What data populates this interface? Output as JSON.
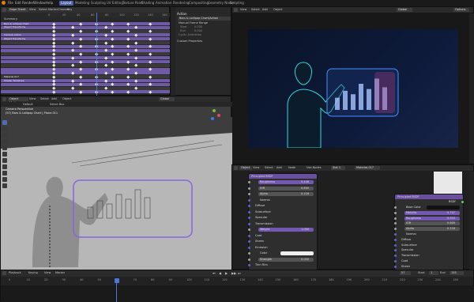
{
  "menu": {
    "file": "File",
    "edit": "Edit",
    "render": "Render",
    "window": "Window",
    "help": "Help"
  },
  "workspaces": [
    "Layout",
    "Modeling",
    "Sculpting",
    "UV Editing",
    "Texture Paint",
    "Shading",
    "Animation",
    "Rendering",
    "Compositing",
    "Geometry Nodes",
    "Scripting"
  ],
  "active_workspace": "Layout",
  "dopesheet": {
    "mode": "Dope Sheet",
    "menus": [
      "View",
      "Select",
      "Marker",
      "Channel",
      "Key"
    ],
    "summary": "Summary",
    "frames": [
      "0",
      "20",
      "40",
      "60",
      "80",
      "100",
      "120",
      "140",
      "160"
    ],
    "channels": [
      "Bars & Lollipop Chart",
      "Object Transforms",
      "",
      "Camera Action",
      "Object Transforms",
      "",
      "",
      "",
      "",
      "",
      "",
      "",
      "",
      "",
      "Material.017",
      "Shader Nodetree",
      "",
      "",
      ""
    ]
  },
  "properties": {
    "section": "Action",
    "action_name": "Bars & Lollipop Chart/Action",
    "manual_range": "Manual Frame Range",
    "start_label": "Start",
    "start_value": "0.000",
    "end_label": "End",
    "end_value": "0.000",
    "cyclic": "Cyclic Animation",
    "custom": "Custom Properties"
  },
  "render_view": {
    "menus": [
      "View",
      "Select",
      "Add",
      "Object"
    ],
    "orientation": "Global",
    "options": "Options",
    "chart_bars": [
      0.35,
      0.55,
      0.45,
      0.75,
      0.6,
      0.9,
      0.65
    ]
  },
  "viewport": {
    "mode": "Object Mode",
    "menus": [
      "View",
      "Select",
      "Add",
      "Object"
    ],
    "orientation": "Default",
    "drag": "Select Box",
    "global": "Global",
    "camera_label": "Camera Perspective",
    "object_label": "(57) Bars & Lollipop Chart | Plane.011"
  },
  "shader_editor": {
    "mode": "Object",
    "menus": [
      "View",
      "Select",
      "Add",
      "Node"
    ],
    "use_nodes": "Use Nodes",
    "slot": "Slot 1",
    "material": "Material.017",
    "left_node": {
      "title": "Principled BSDF",
      "rows": [
        {
          "label": "Roughness",
          "value": "0.448",
          "purple": true
        },
        {
          "label": "IOR",
          "value": "0.800",
          "purple": false
        },
        {
          "label": "Alpha",
          "value": "0.116",
          "purple": false
        },
        {
          "label": "Normal",
          "value": "",
          "purple": false
        },
        {
          "label": "Diffuse",
          "value": "",
          "purple": false
        },
        {
          "label": "Subsurface",
          "value": "",
          "purple": false
        },
        {
          "label": "Specular",
          "value": "",
          "purple": false
        },
        {
          "label": "Transmission",
          "value": "",
          "purple": false
        },
        {
          "label": "Weight",
          "value": "1.000",
          "purple": true
        },
        {
          "label": "Coat",
          "value": "",
          "purple": false
        },
        {
          "label": "Sheen",
          "value": "",
          "purple": false
        },
        {
          "label": "Emission",
          "value": "",
          "purple": false
        },
        {
          "label": "Color",
          "value": "",
          "purple": false
        },
        {
          "label": "Strength",
          "value": "0.000",
          "purple": false
        },
        {
          "label": "Thin Film",
          "value": "",
          "purple": false
        }
      ]
    },
    "right_node": {
      "title": "Principled BSDF",
      "output": "BSDF",
      "rows": [
        {
          "label": "Base Color",
          "value": ""
        },
        {
          "label": "Metallic",
          "value": "0.707"
        },
        {
          "label": "Roughness",
          "value": "0.515"
        },
        {
          "label": "IOR",
          "value": "0.800"
        },
        {
          "label": "Alpha",
          "value": "0.116"
        },
        {
          "label": "Normal",
          "value": ""
        },
        {
          "label": "Diffuse",
          "value": ""
        },
        {
          "label": "Subsurface",
          "value": ""
        },
        {
          "label": "Specular",
          "value": ""
        },
        {
          "label": "Transmission",
          "value": ""
        },
        {
          "label": "Coat",
          "value": ""
        },
        {
          "label": "Sheen",
          "value": ""
        }
      ]
    }
  },
  "timeline": {
    "playback": "Playback",
    "keying": "Keying",
    "menus": [
      "View",
      "Marker"
    ],
    "frames": [
      "0",
      "10",
      "20",
      "30",
      "40",
      "50",
      "60",
      "70",
      "80",
      "90",
      "100",
      "110",
      "120",
      "130",
      "140",
      "150",
      "160",
      "170",
      "180",
      "190",
      "200",
      "210",
      "220",
      "230",
      "240",
      "250"
    ],
    "current_frame": "57",
    "start_label": "Start",
    "start_value": "1",
    "end_label": "End",
    "end_value": "155"
  },
  "colors": {
    "accent": "#7357b3",
    "keyframe_row": "#6e5aa6",
    "selection": "#8a63e0",
    "playhead": "#4a78d8"
  }
}
